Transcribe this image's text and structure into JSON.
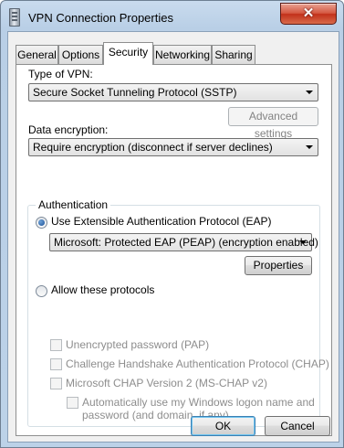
{
  "window": {
    "title": "VPN Connection Properties",
    "close_glyph": "✕",
    "title_icon": "vpn-connection-icon"
  },
  "tabs": [
    {
      "label": "General",
      "active": false
    },
    {
      "label": "Options",
      "active": false
    },
    {
      "label": "Security",
      "active": true
    },
    {
      "label": "Networking",
      "active": false
    },
    {
      "label": "Sharing",
      "active": false
    }
  ],
  "security": {
    "vpn_type_label": "Type of VPN:",
    "vpn_type_value": "Secure Socket Tunneling Protocol (SSTP)",
    "advanced_settings_label": "Advanced settings",
    "encryption_label": "Data encryption:",
    "encryption_value": "Require encryption (disconnect if server declines)",
    "auth_group_label": "Authentication",
    "eap_option_label": "Use Extensible Authentication Protocol (EAP)",
    "eap_option_checked": true,
    "eap_method_value": "Microsoft: Protected EAP (PEAP) (encryption enabled)",
    "properties_label": "Properties",
    "allow_protocols_label": "Allow these protocols",
    "allow_protocols_checked": false,
    "protocols": [
      {
        "label": "Unencrypted password (PAP)",
        "checked": false,
        "enabled": false
      },
      {
        "label": "Challenge Handshake Authentication Protocol (CHAP)",
        "checked": false,
        "enabled": false
      },
      {
        "label": "Microsoft CHAP Version 2 (MS-CHAP v2)",
        "checked": false,
        "enabled": false
      }
    ],
    "windows_logon_label_line1": "Automatically use my Windows logon name and",
    "windows_logon_label_line2": "password (and domain, if any)"
  },
  "footer": {
    "ok_label": "OK",
    "cancel_label": "Cancel"
  }
}
